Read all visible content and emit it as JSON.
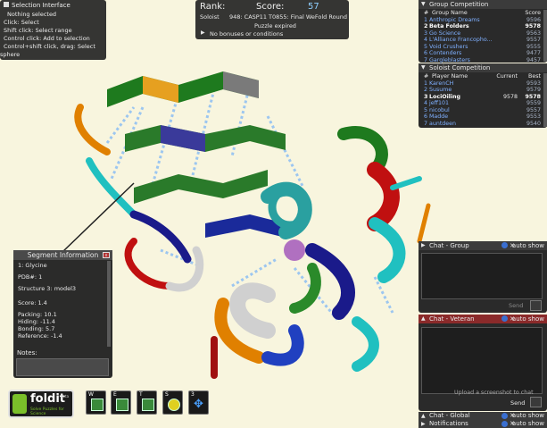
{
  "selection": {
    "title": "Selection Interface",
    "lines": [
      "Nothing selected",
      "Click: Select",
      "Shift click: Select range",
      "Control click: Add to selection",
      "Control+shift click, drag: Select",
      "sphere"
    ]
  },
  "rank": {
    "rank_label": "Rank:",
    "score_label": "Score:",
    "score_value": "57",
    "soloist_label": "Soloist",
    "puzzle_title": "948: CASP11 T0855: Final WeFold Round",
    "status": "Puzzle expired",
    "bonus_toggle": "No bonuses or conditions"
  },
  "group_competition": {
    "title": "Group Competition",
    "headers": {
      "num": "#",
      "name": "Group Name",
      "score": "Score"
    },
    "rows": [
      {
        "rank": "1",
        "name": "Anthropic Dreams",
        "score": "9596"
      },
      {
        "rank": "2",
        "name": "Beta Folders",
        "score": "9578"
      },
      {
        "rank": "3",
        "name": "Go Science",
        "score": "9563"
      },
      {
        "rank": "4",
        "name": "L'Alliance Francopho...",
        "score": "9557"
      },
      {
        "rank": "5",
        "name": "Void Crushers",
        "score": "9555"
      },
      {
        "rank": "6",
        "name": "Contenders",
        "score": "9477"
      },
      {
        "rank": "7",
        "name": "Gargleblasters",
        "score": "9457"
      }
    ],
    "highlight_index": 1
  },
  "soloist_competition": {
    "title": "Soloist Competition",
    "headers": {
      "num": "#",
      "name": "Player Name",
      "current": "Current",
      "best": "Best"
    },
    "rows": [
      {
        "rank": "1",
        "name": "KarenCH",
        "current": "",
        "best": "9593"
      },
      {
        "rank": "2",
        "name": "Susume",
        "current": "",
        "best": "9579"
      },
      {
        "rank": "3",
        "name": "LociOiling",
        "current": "9578",
        "best": "9578"
      },
      {
        "rank": "4",
        "name": "jeff101",
        "current": "",
        "best": "9559"
      },
      {
        "rank": "5",
        "name": "nicobul",
        "current": "",
        "best": "9557"
      },
      {
        "rank": "6",
        "name": "Madde",
        "current": "",
        "best": "9553"
      },
      {
        "rank": "7",
        "name": "auntdeen",
        "current": "",
        "best": "9540"
      }
    ],
    "highlight_index": 2
  },
  "chat_group": {
    "title": "Chat - Group",
    "auto_show": "auto show",
    "send": "Send"
  },
  "chat_veteran": {
    "title": "Chat - Veteran",
    "auto_show": "auto show",
    "send": "Send",
    "hint": "Upload a screenshot to chat"
  },
  "chat_global": {
    "title": "Chat - Global",
    "auto_show": "auto show"
  },
  "notifications": {
    "title": "Notifications",
    "auto_show": "auto show"
  },
  "segment_info": {
    "title": "Segment Information",
    "residue": "1: Glycine",
    "pdb": "PDB#:   1",
    "structure": "Structure 3: model3",
    "score": "Score: 1.4",
    "packing": "Packing: 10.1",
    "hiding": "Hiding: -11.4",
    "bonding": "Bonding: 5.7",
    "reference": "Reference: -1.4",
    "notes_label": "Notes:"
  },
  "logo": {
    "name": "foldit",
    "tagline": "Solve Puzzles for Science",
    "beta": "beta"
  },
  "toolbar": {
    "keys": [
      "W",
      "E",
      "T",
      "S",
      "3"
    ]
  }
}
